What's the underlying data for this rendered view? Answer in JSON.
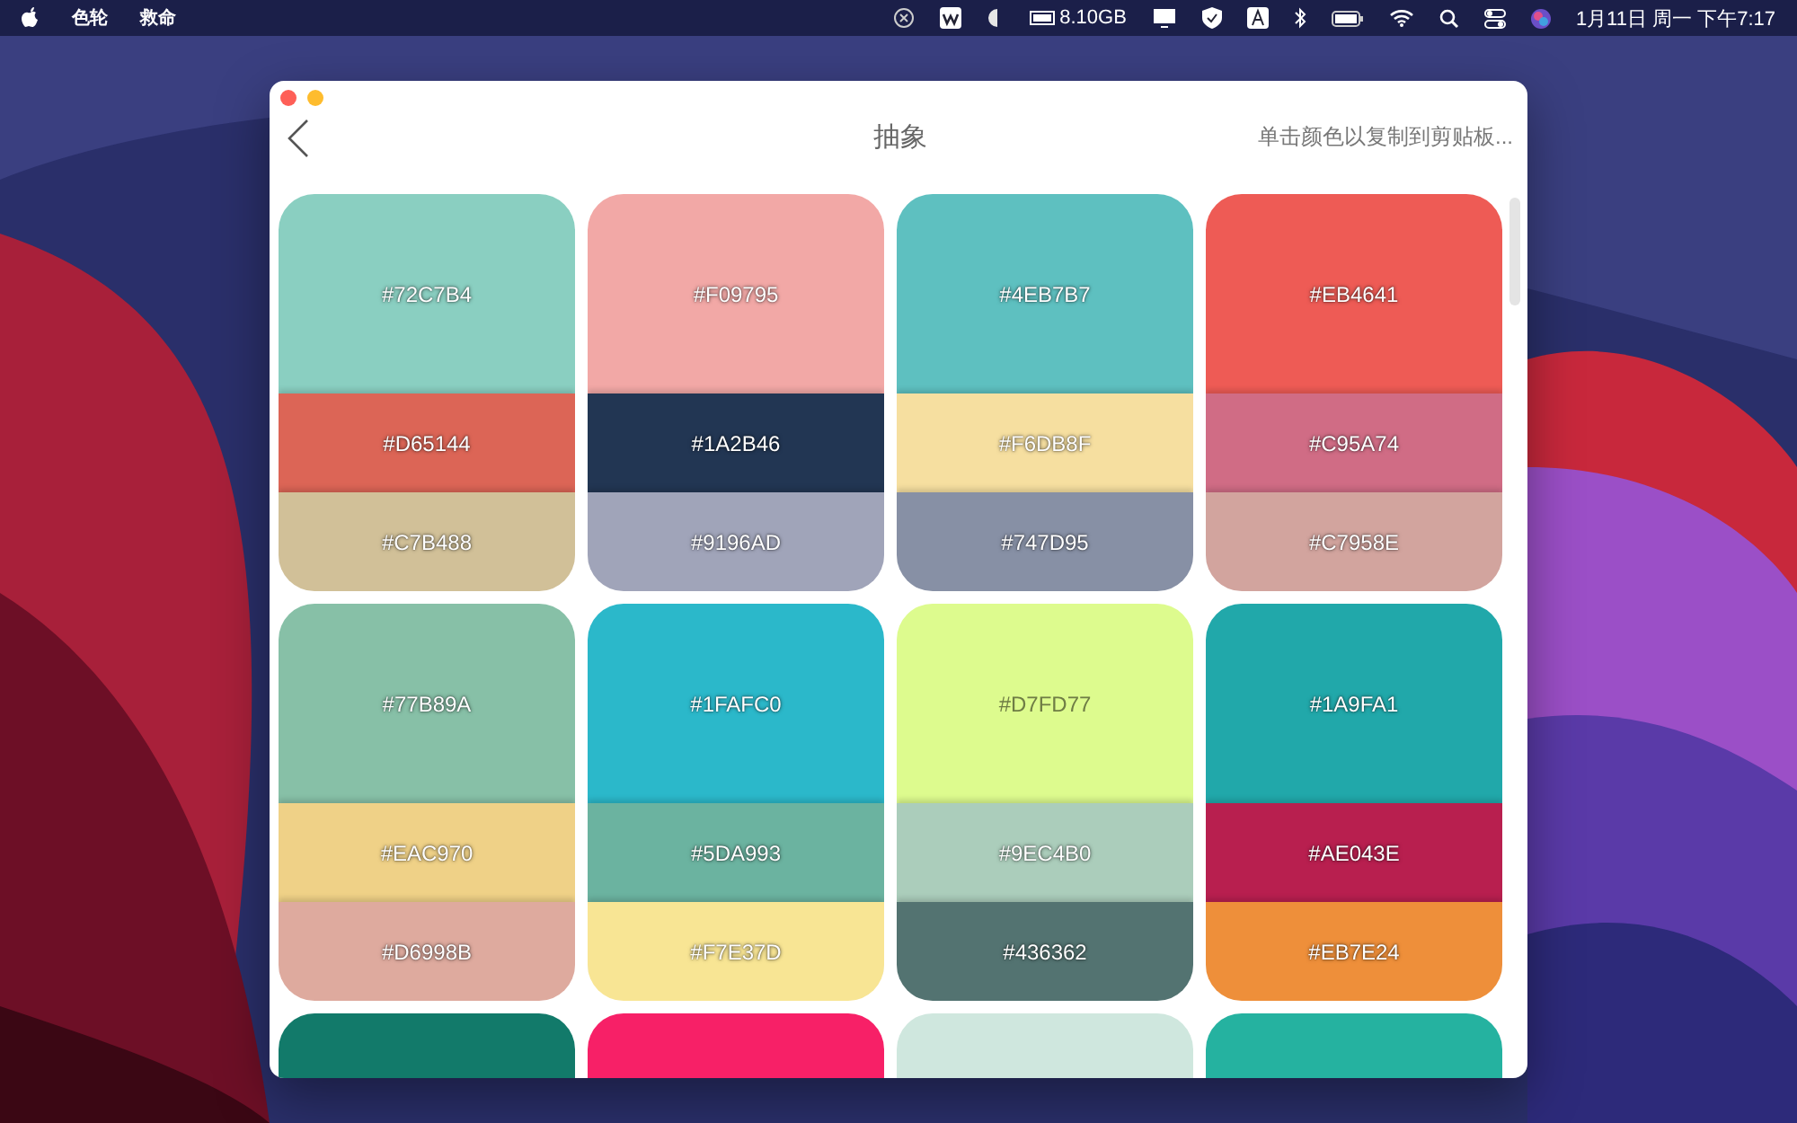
{
  "menubar": {
    "menus": [
      "色轮",
      "救命"
    ],
    "memory": "8.10GB",
    "clock": "1月11日 周一 下午7:17"
  },
  "window": {
    "title": "抽象",
    "hint": "单击颜色以复制到剪贴板..."
  },
  "palettes": [
    {
      "swatches": [
        {
          "label": "#72C7B4",
          "color": "#8acfc1"
        },
        {
          "label": "#D65144",
          "color": "#dc6556"
        },
        {
          "label": "#C7B488",
          "color": "#d1c098"
        }
      ]
    },
    {
      "swatches": [
        {
          "label": "#F09795",
          "color": "#f2a8a6"
        },
        {
          "label": "#1A2B46",
          "color": "#223653"
        },
        {
          "label": "#9196AD",
          "color": "#a0a4b9"
        }
      ]
    },
    {
      "swatches": [
        {
          "label": "#4EB7B7",
          "color": "#5ec0c0"
        },
        {
          "label": "#F6DB8F",
          "color": "#f6dfa0"
        },
        {
          "label": "#747D95",
          "color": "#8790a5"
        }
      ]
    },
    {
      "swatches": [
        {
          "label": "#EB4641",
          "color": "#ee5b55"
        },
        {
          "label": "#C95A74",
          "color": "#d06c85"
        },
        {
          "label": "#C7958E",
          "color": "#d2a49e"
        }
      ]
    },
    {
      "swatches": [
        {
          "label": "#77B89A",
          "color": "#87c0a7"
        },
        {
          "label": "#EAC970",
          "color": "#efd187"
        },
        {
          "label": "#D6998B",
          "color": "#deaa9e"
        }
      ]
    },
    {
      "swatches": [
        {
          "label": "#1FAFC0",
          "color": "#2bb8ca"
        },
        {
          "label": "#5DA993",
          "color": "#6bb3a0"
        },
        {
          "label": "#F7E37D",
          "color": "#f8e594"
        }
      ]
    },
    {
      "swatches": [
        {
          "label": "#D7FD77",
          "color": "#ddfb8e"
        },
        {
          "label": "#9EC4B0",
          "color": "#abcdbb"
        },
        {
          "label": "#436362",
          "color": "#537371"
        }
      ]
    },
    {
      "swatches": [
        {
          "label": "#1A9FA1",
          "color": "#21a8aa"
        },
        {
          "label": "#AE043E",
          "color": "#b81f4f"
        },
        {
          "label": "#EB7E24",
          "color": "#ee8f3a"
        }
      ]
    },
    {
      "swatches": [
        {
          "color": "#127a6a"
        }
      ]
    },
    {
      "swatches": [
        {
          "color": "#f72067"
        }
      ]
    },
    {
      "swatches": [
        {
          "color": "#cfe7de"
        }
      ]
    },
    {
      "swatches": [
        {
          "color": "#25b2a0"
        }
      ]
    }
  ]
}
